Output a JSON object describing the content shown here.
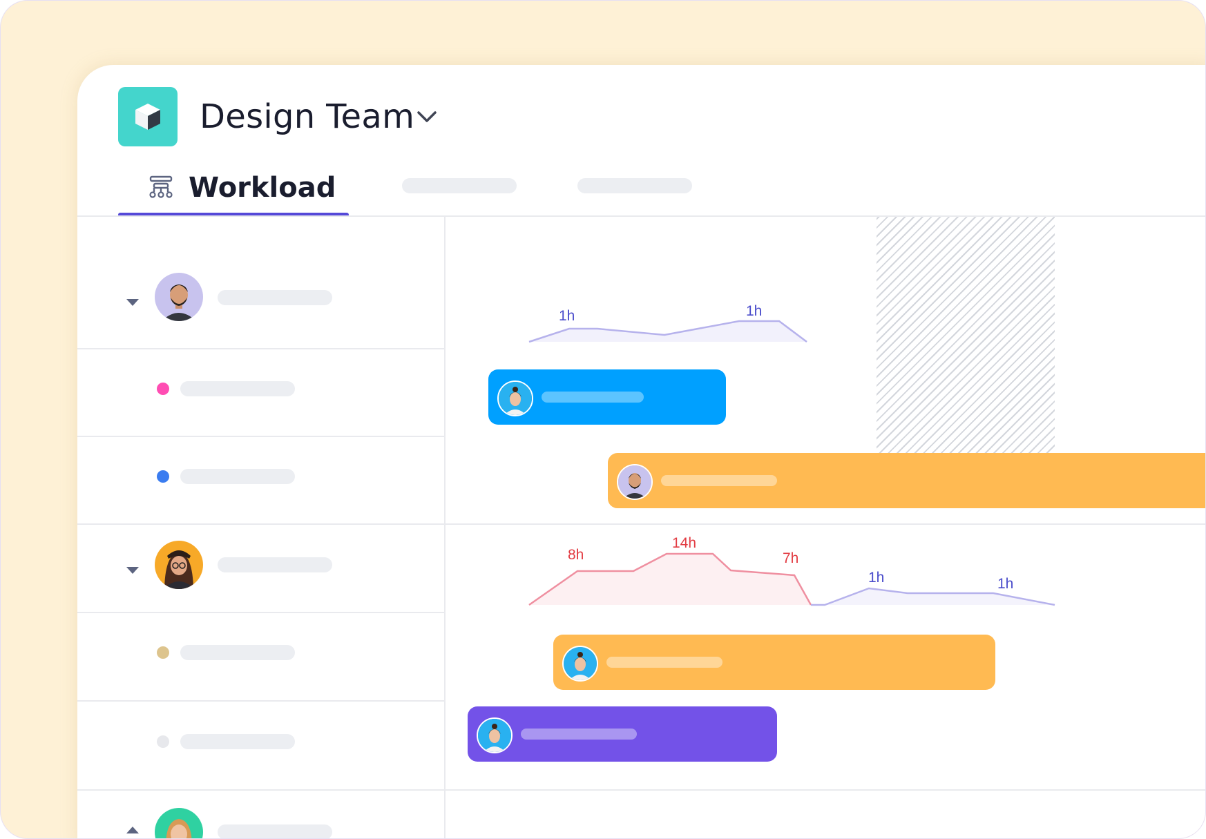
{
  "header": {
    "team_name": "Design Team",
    "app_icon": "cube-icon",
    "dropdown_icon": "chevron-down-icon"
  },
  "tabs": [
    {
      "label": "Workload",
      "icon": "hierarchy-icon",
      "active": true
    },
    {
      "label": "",
      "placeholder": true
    },
    {
      "label": "",
      "placeholder": true
    }
  ],
  "colors": {
    "accent": "#5549d8",
    "app_icon_bg": "#44d5cc",
    "bar_blue": "#00a0ff",
    "bar_orange": "#ffba52",
    "bar_purple": "#7352e8",
    "overload_line": "#ef8fa0",
    "normal_line": "#b6b2ec",
    "label_red": "#e23b42",
    "label_blue": "#4a4ccb"
  },
  "members": [
    {
      "expanded": true,
      "avatar_bg": "#c8c3ee",
      "workload": [
        {
          "label": "1h",
          "level": "normal"
        },
        {
          "label": "1h",
          "level": "normal"
        }
      ],
      "tasks": [
        {
          "dot_color": "#ff4db3",
          "bar_color": "#00a0ff",
          "assignee_avatar_bg": "#29b1f0"
        },
        {
          "dot_color": "#3a7cf0",
          "bar_color": "#ffba52",
          "assignee_avatar_bg": "#c8c3ee"
        }
      ]
    },
    {
      "expanded": true,
      "avatar_bg": "#f7a928",
      "workload": [
        {
          "label": "8h",
          "level": "overload"
        },
        {
          "label": "14h",
          "level": "overload"
        },
        {
          "label": "7h",
          "level": "overload"
        },
        {
          "label": "1h",
          "level": "normal"
        },
        {
          "label": "1h",
          "level": "normal"
        }
      ],
      "tasks": [
        {
          "dot_color": "#ddc48d",
          "bar_color": "#ffba52",
          "assignee_avatar_bg": "#29b1f0"
        },
        {
          "dot_color": "#e7e8ec",
          "bar_color": "#7352e8",
          "assignee_avatar_bg": "#29b1f0"
        }
      ]
    },
    {
      "expanded": false,
      "avatar_bg": "#2fd1a1"
    }
  ]
}
